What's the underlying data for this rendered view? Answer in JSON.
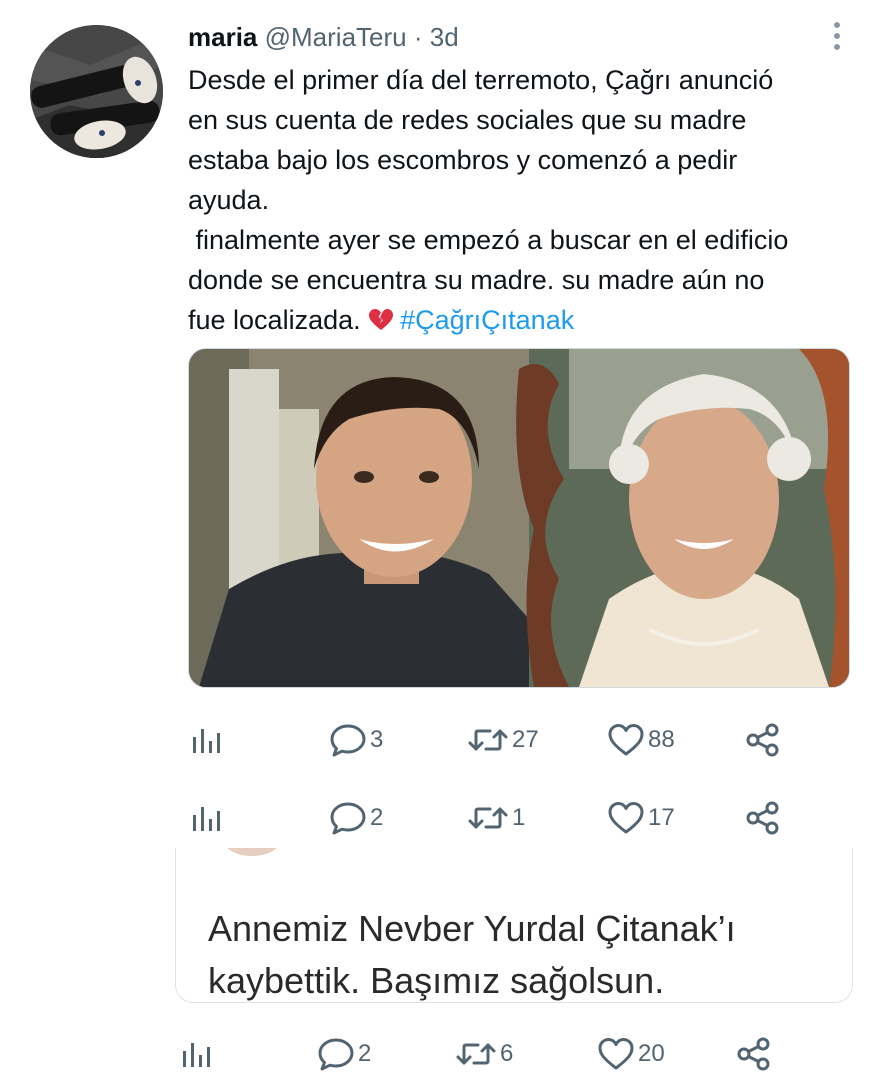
{
  "tweet": {
    "author_name": "maria",
    "author_handle": "@MariaTeru",
    "separator": "·",
    "time": "3d",
    "text_main": "Desde el primer día del terremoto, Çağrı anunció\nen sus cuenta de redes sociales que su madre\nestaba bajo los escombros y comenzó a pedir\nayuda.\n finalmente ayer se empezó a buscar en el edificio\ndonde se encuentra su madre. su madre aún no\nfue localizada. ",
    "hashtag": "#ÇağrıÇıtanak"
  },
  "action_rows": [
    {
      "replies": "3",
      "retweets": "27",
      "likes": "88"
    },
    {
      "replies": "2",
      "retweets": "1",
      "likes": "17"
    },
    {
      "replies": "2",
      "retweets": "6",
      "likes": "20"
    }
  ],
  "quote": {
    "text": "Annemiz Nevber Yurdal Çitanak’ı\nkaybettik. Başımız sağolsun."
  },
  "icons": {
    "views": "bar-chart-icon",
    "reply": "speech-bubble-icon",
    "retweet": "retweet-arrows-icon",
    "like": "heart-outline-icon",
    "share": "share-nodes-icon",
    "emoji": "broken-heart-icon",
    "more": "vertical-ellipsis-icon"
  },
  "colors": {
    "text": "#0f1419",
    "secondary": "#536471",
    "link": "#1d9bf0",
    "icon": "#536471"
  }
}
